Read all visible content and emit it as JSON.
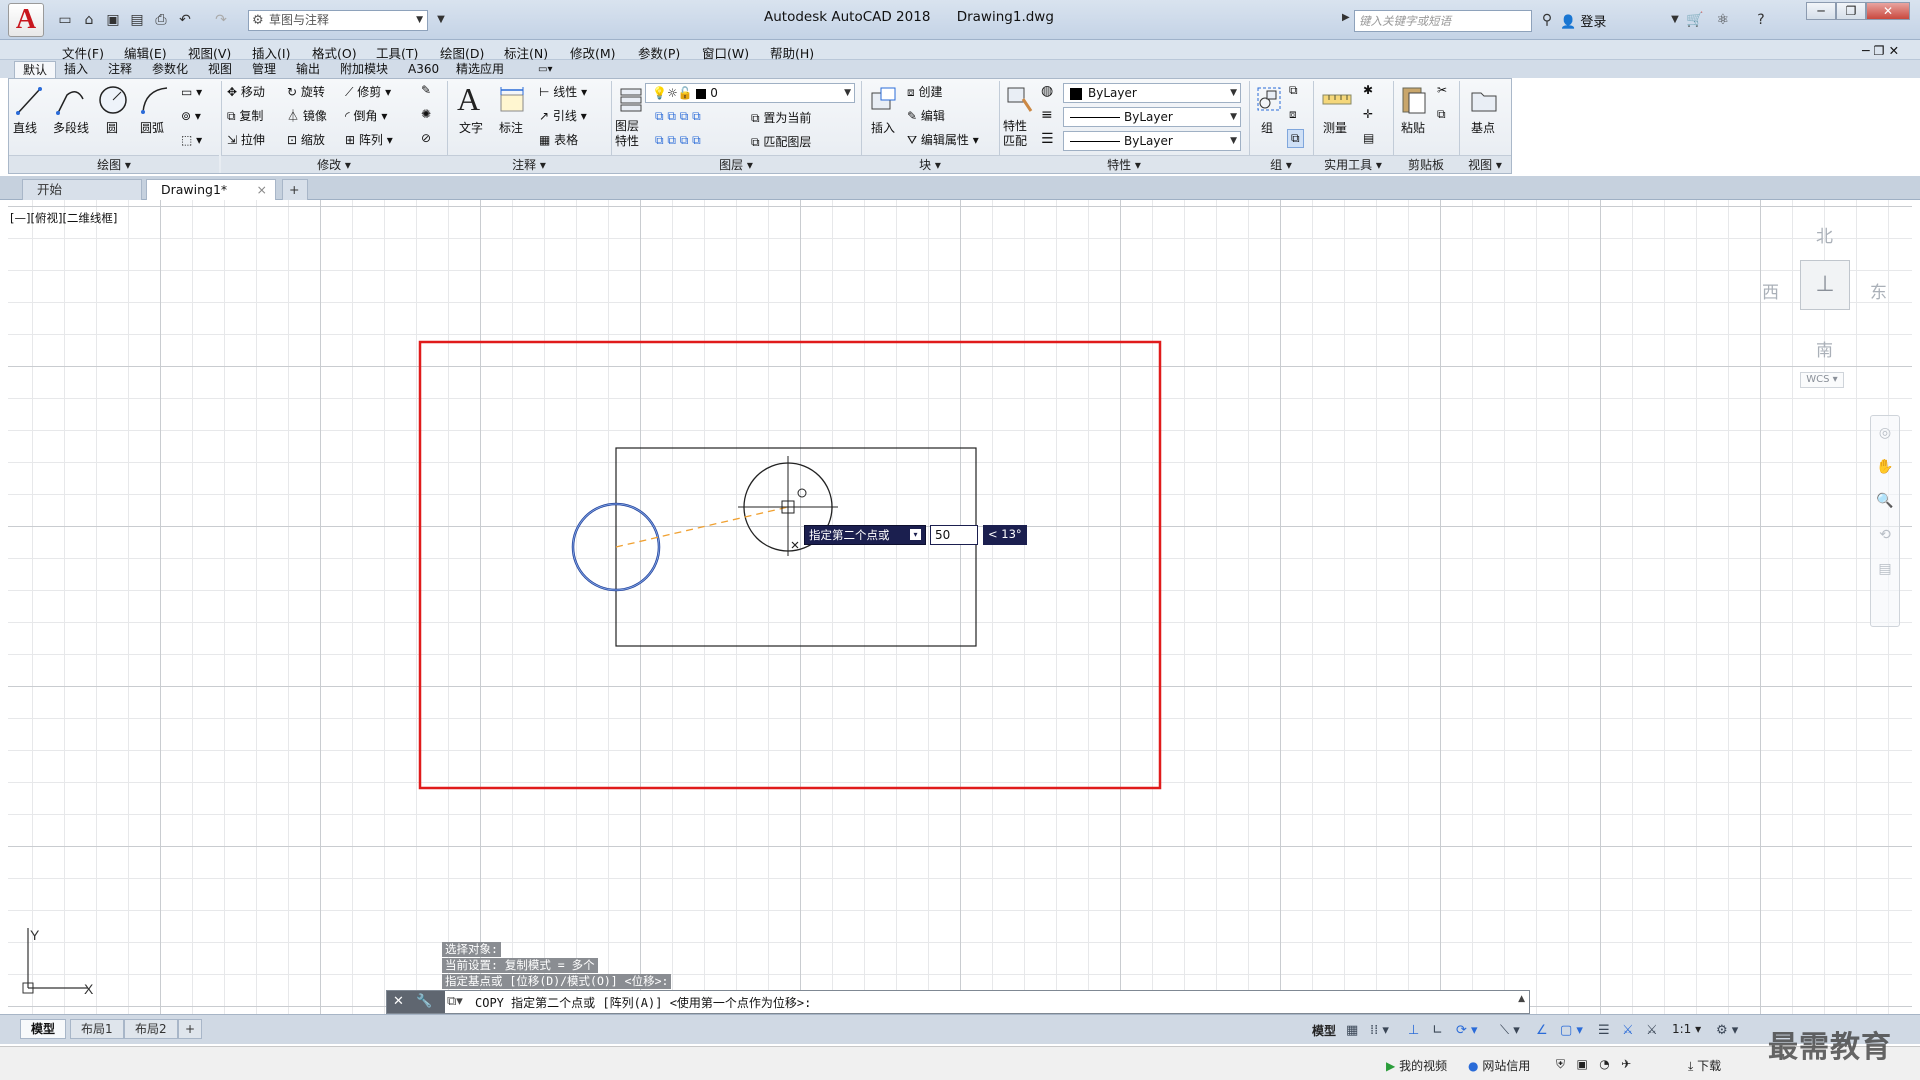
{
  "title_bar": {
    "app_name": "Autodesk AutoCAD 2018",
    "document": "Drawing1.dwg",
    "workspace": "草图与注释",
    "search_placeholder": "键入关键字或短语",
    "login": "登录"
  },
  "menu": [
    "文件(F)",
    "编辑(E)",
    "视图(V)",
    "插入(I)",
    "格式(O)",
    "工具(T)",
    "绘图(D)",
    "标注(N)",
    "修改(M)",
    "参数(P)",
    "窗口(W)",
    "帮助(H)"
  ],
  "ribbon_tabs": [
    "默认",
    "插入",
    "注释",
    "参数化",
    "视图",
    "管理",
    "输出",
    "附加模块",
    "A360",
    "精选应用"
  ],
  "ribbon": {
    "draw": {
      "title": "绘图",
      "line": "直线",
      "polyline": "多段线",
      "circle": "圆",
      "arc": "圆弧"
    },
    "modify": {
      "title": "修改",
      "move": "移动",
      "rotate": "旋转",
      "trim": "修剪",
      "copy": "复制",
      "mirror": "镜像",
      "fillet": "倒角",
      "stretch": "拉伸",
      "scale": "缩放",
      "array": "阵列"
    },
    "annotation": {
      "title": "注释",
      "text": "文字",
      "dimension": "标注",
      "linear": "线性",
      "leader": "引线",
      "table": "表格"
    },
    "layers": {
      "title": "图层",
      "properties": "图层特性",
      "current_layer": "0",
      "set_current": "置为当前",
      "match": "匹配图层"
    },
    "block": {
      "title": "块",
      "insert": "插入",
      "create": "创建",
      "edit": "编辑",
      "edit_attr": "编辑属性"
    },
    "properties": {
      "title": "特性",
      "match": "特性匹配",
      "color": "ByLayer",
      "linetype": "ByLayer",
      "lineweight": "ByLayer"
    },
    "groups": {
      "title": "组",
      "group": "组"
    },
    "utilities": {
      "title": "实用工具",
      "measure": "测量"
    },
    "clipboard": {
      "title": "剪贴板",
      "paste": "粘贴"
    },
    "view": {
      "title": "视图",
      "base": "基点"
    }
  },
  "file_tabs": {
    "start": "开始",
    "drawing": "Drawing1*"
  },
  "viewport_label": "[—][俯视][二维线框]",
  "viewcube": {
    "north": "北",
    "south": "南",
    "east": "东",
    "west": "西",
    "wcs": "WCS"
  },
  "dynamic_input": {
    "prompt": "指定第二个点或",
    "value": "50",
    "angle": "< 13°"
  },
  "command_history": [
    "选择对象:",
    "当前设置:  复制模式 = 多个",
    "指定基点或 [位移(D)/模式(O)] <位移>:"
  ],
  "command_line": "COPY 指定第二个点或 [阵列(A)] <使用第一个点作为位移>:",
  "layout_tabs": [
    "模型",
    "布局1",
    "布局2"
  ],
  "status": {
    "model": "模型",
    "scale": "1:1"
  },
  "taskbar": {
    "video": "我的视频",
    "network": "网站信用",
    "download": "下载"
  },
  "watermark": "最需教育",
  "colors": {
    "highlight_rect": "#e01b1b",
    "selected_circle": "#1f3f9a",
    "rubber_band": "#f0a030",
    "dyn_bg": "#1b1f4f"
  }
}
